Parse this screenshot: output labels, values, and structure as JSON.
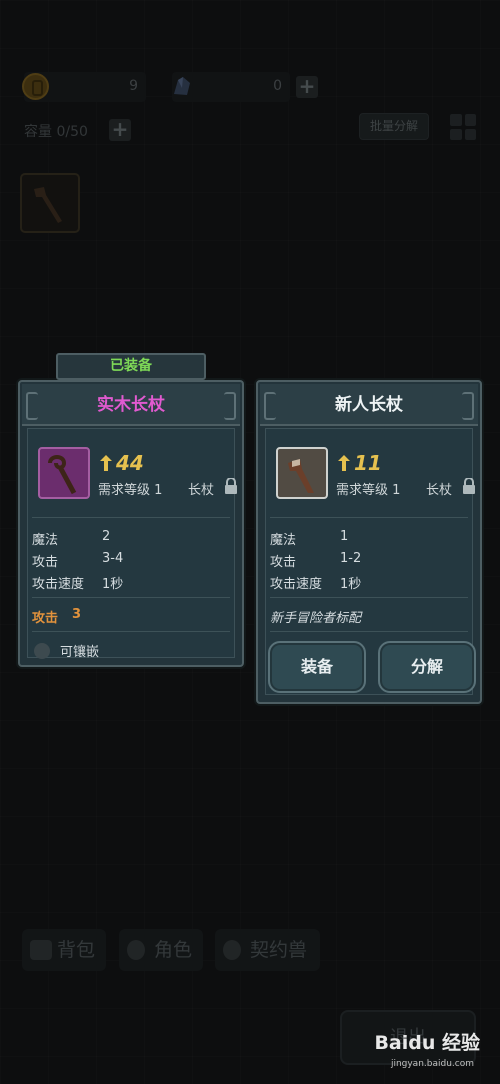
{
  "resources": {
    "gold": "9",
    "gems": "0"
  },
  "inventory": {
    "capacity_label": "容量 0/50",
    "bulk_decompose": "批量分解"
  },
  "equipped_card": {
    "tab_label": "已装备",
    "name": "实木长杖",
    "name_color": "#e15ad0",
    "level": "44",
    "requirement": "需求等级 1",
    "type": "长杖",
    "stats": [
      {
        "label": "魔法",
        "value": "2"
      },
      {
        "label": "攻击",
        "value": "3-4"
      },
      {
        "label": "攻击速度",
        "value": "1秒"
      }
    ],
    "bonus_label": "攻击",
    "bonus_value": "3",
    "socket_label": "可镶嵌"
  },
  "new_card": {
    "name": "新人长杖",
    "name_color": "#eef3f4",
    "level": "11",
    "requirement": "需求等级 1",
    "type": "长杖",
    "stats": [
      {
        "label": "魔法",
        "value": "1"
      },
      {
        "label": "攻击",
        "value": "1-2"
      },
      {
        "label": "攻击速度",
        "value": "1秒"
      }
    ],
    "description": "新手冒险者标配",
    "equip_button": "装备",
    "decompose_button": "分解"
  },
  "bottom_nav": {
    "bag": "背包",
    "role": "角色",
    "pet": "契约兽"
  },
  "exit_button": "退出",
  "watermark": {
    "brand": "Baidu 经验",
    "url": "jingyan.baidu.com"
  }
}
